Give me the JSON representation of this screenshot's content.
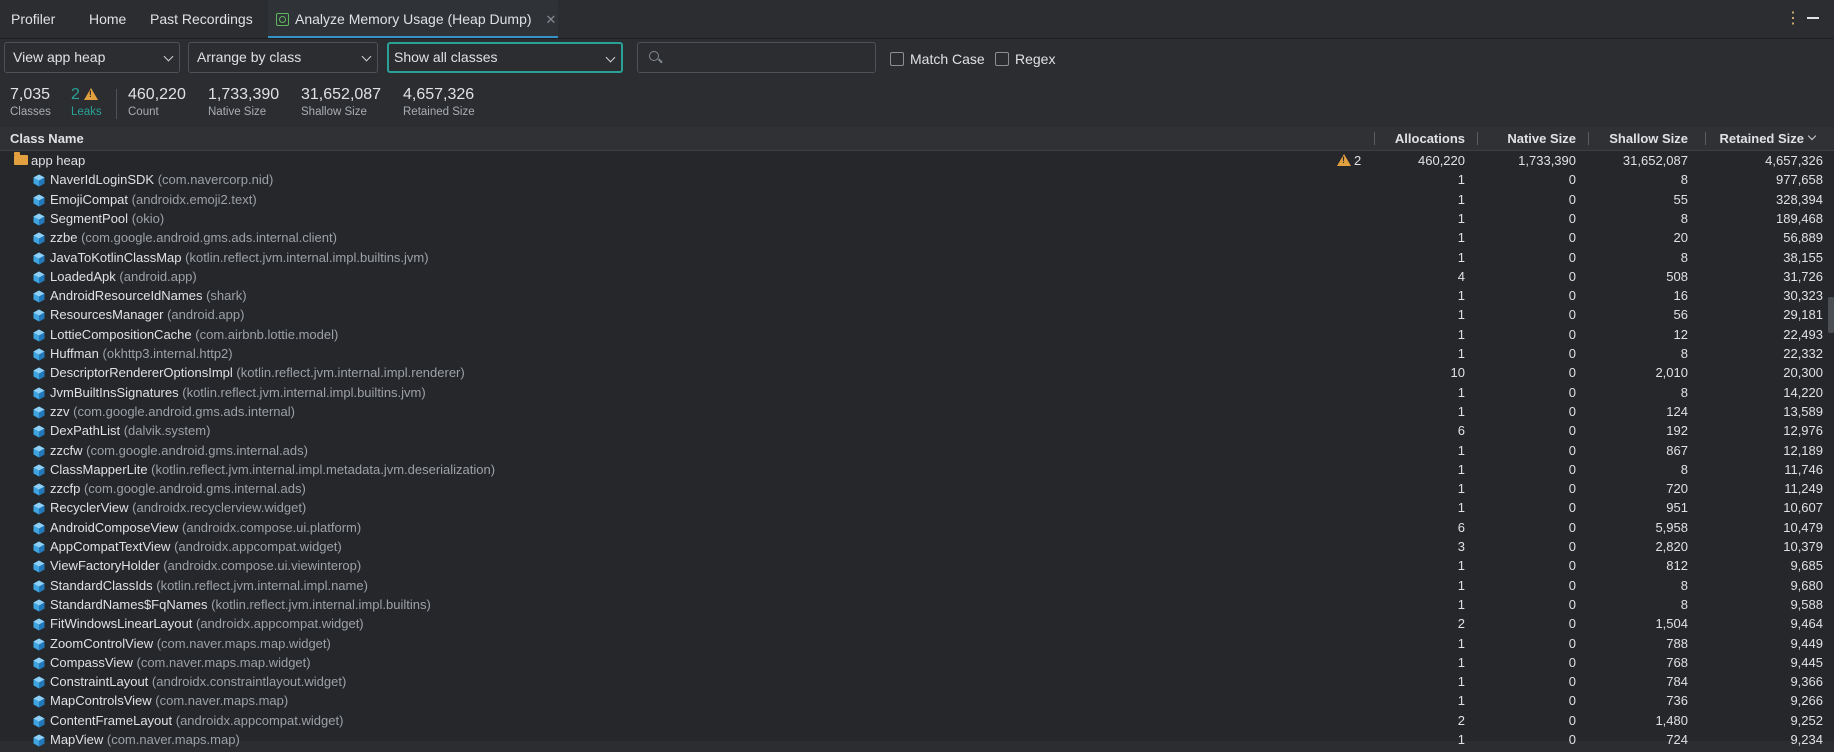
{
  "tabs": [
    {
      "label": "Profiler"
    },
    {
      "label": "Home"
    },
    {
      "label": "Past Recordings"
    },
    {
      "label": "Analyze Memory Usage (Heap Dump)",
      "active": true
    }
  ],
  "filters": {
    "heap": "View app heap",
    "arrange": "Arrange by class",
    "show": "Show all classes",
    "search_value": "",
    "match_case": "Match Case",
    "regex": "Regex"
  },
  "stats": {
    "classes": {
      "value": "7,035",
      "label": "Classes"
    },
    "leaks": {
      "value": "2",
      "label": "Leaks"
    },
    "count": {
      "value": "460,220",
      "label": "Count"
    },
    "native": {
      "value": "1,733,390",
      "label": "Native Size"
    },
    "shallow": {
      "value": "31,652,087",
      "label": "Shallow Size"
    },
    "retained": {
      "value": "4,657,326",
      "label": "Retained Size"
    }
  },
  "columns": {
    "class_name": "Class Name",
    "allocations": "Allocations",
    "native_size": "Native Size",
    "shallow_size": "Shallow Size",
    "retained_size": "Retained Size"
  },
  "heap_row": {
    "name": "app heap",
    "leaks": "2",
    "allocations": "460,220",
    "native": "1,733,390",
    "shallow": "31,652,087",
    "retained": "4,657,326"
  },
  "rows": [
    {
      "name": "NaverIdLoginSDK",
      "pkg": "(com.navercorp.nid)",
      "alloc": "1",
      "native": "0",
      "shallow": "8",
      "retained": "977,658"
    },
    {
      "name": "EmojiCompat",
      "pkg": "(androidx.emoji2.text)",
      "alloc": "1",
      "native": "0",
      "shallow": "55",
      "retained": "328,394"
    },
    {
      "name": "SegmentPool",
      "pkg": "(okio)",
      "alloc": "1",
      "native": "0",
      "shallow": "8",
      "retained": "189,468"
    },
    {
      "name": "zzbe",
      "pkg": "(com.google.android.gms.ads.internal.client)",
      "alloc": "1",
      "native": "0",
      "shallow": "20",
      "retained": "56,889"
    },
    {
      "name": "JavaToKotlinClassMap",
      "pkg": "(kotlin.reflect.jvm.internal.impl.builtins.jvm)",
      "alloc": "1",
      "native": "0",
      "shallow": "8",
      "retained": "38,155"
    },
    {
      "name": "LoadedApk",
      "pkg": "(android.app)",
      "alloc": "4",
      "native": "0",
      "shallow": "508",
      "retained": "31,726"
    },
    {
      "name": "AndroidResourceIdNames",
      "pkg": "(shark)",
      "alloc": "1",
      "native": "0",
      "shallow": "16",
      "retained": "30,323"
    },
    {
      "name": "ResourcesManager",
      "pkg": "(android.app)",
      "alloc": "1",
      "native": "0",
      "shallow": "56",
      "retained": "29,181"
    },
    {
      "name": "LottieCompositionCache",
      "pkg": "(com.airbnb.lottie.model)",
      "alloc": "1",
      "native": "0",
      "shallow": "12",
      "retained": "22,493"
    },
    {
      "name": "Huffman",
      "pkg": "(okhttp3.internal.http2)",
      "alloc": "1",
      "native": "0",
      "shallow": "8",
      "retained": "22,332"
    },
    {
      "name": "DescriptorRendererOptionsImpl",
      "pkg": "(kotlin.reflect.jvm.internal.impl.renderer)",
      "alloc": "10",
      "native": "0",
      "shallow": "2,010",
      "retained": "20,300"
    },
    {
      "name": "JvmBuiltInsSignatures",
      "pkg": "(kotlin.reflect.jvm.internal.impl.builtins.jvm)",
      "alloc": "1",
      "native": "0",
      "shallow": "8",
      "retained": "14,220"
    },
    {
      "name": "zzv",
      "pkg": "(com.google.android.gms.ads.internal)",
      "alloc": "1",
      "native": "0",
      "shallow": "124",
      "retained": "13,589"
    },
    {
      "name": "DexPathList",
      "pkg": "(dalvik.system)",
      "alloc": "6",
      "native": "0",
      "shallow": "192",
      "retained": "12,976"
    },
    {
      "name": "zzcfw",
      "pkg": "(com.google.android.gms.internal.ads)",
      "alloc": "1",
      "native": "0",
      "shallow": "867",
      "retained": "12,189"
    },
    {
      "name": "ClassMapperLite",
      "pkg": "(kotlin.reflect.jvm.internal.impl.metadata.jvm.deserialization)",
      "alloc": "1",
      "native": "0",
      "shallow": "8",
      "retained": "11,746"
    },
    {
      "name": "zzcfp",
      "pkg": "(com.google.android.gms.internal.ads)",
      "alloc": "1",
      "native": "0",
      "shallow": "720",
      "retained": "11,249"
    },
    {
      "name": "RecyclerView",
      "pkg": "(androidx.recyclerview.widget)",
      "alloc": "1",
      "native": "0",
      "shallow": "951",
      "retained": "10,607"
    },
    {
      "name": "AndroidComposeView",
      "pkg": "(androidx.compose.ui.platform)",
      "alloc": "6",
      "native": "0",
      "shallow": "5,958",
      "retained": "10,479"
    },
    {
      "name": "AppCompatTextView",
      "pkg": "(androidx.appcompat.widget)",
      "alloc": "3",
      "native": "0",
      "shallow": "2,820",
      "retained": "10,379"
    },
    {
      "name": "ViewFactoryHolder",
      "pkg": "(androidx.compose.ui.viewinterop)",
      "alloc": "1",
      "native": "0",
      "shallow": "812",
      "retained": "9,685"
    },
    {
      "name": "StandardClassIds",
      "pkg": "(kotlin.reflect.jvm.internal.impl.name)",
      "alloc": "1",
      "native": "0",
      "shallow": "8",
      "retained": "9,680"
    },
    {
      "name": "StandardNames$FqNames",
      "pkg": "(kotlin.reflect.jvm.internal.impl.builtins)",
      "alloc": "1",
      "native": "0",
      "shallow": "8",
      "retained": "9,588"
    },
    {
      "name": "FitWindowsLinearLayout",
      "pkg": "(androidx.appcompat.widget)",
      "alloc": "2",
      "native": "0",
      "shallow": "1,504",
      "retained": "9,464"
    },
    {
      "name": "ZoomControlView",
      "pkg": "(com.naver.maps.map.widget)",
      "alloc": "1",
      "native": "0",
      "shallow": "788",
      "retained": "9,449"
    },
    {
      "name": "CompassView",
      "pkg": "(com.naver.maps.map.widget)",
      "alloc": "1",
      "native": "0",
      "shallow": "768",
      "retained": "9,445"
    },
    {
      "name": "ConstraintLayout",
      "pkg": "(androidx.constraintlayout.widget)",
      "alloc": "1",
      "native": "0",
      "shallow": "784",
      "retained": "9,366"
    },
    {
      "name": "MapControlsView",
      "pkg": "(com.naver.maps.map)",
      "alloc": "1",
      "native": "0",
      "shallow": "736",
      "retained": "9,266"
    },
    {
      "name": "ContentFrameLayout",
      "pkg": "(androidx.appcompat.widget)",
      "alloc": "2",
      "native": "0",
      "shallow": "1,480",
      "retained": "9,252"
    },
    {
      "name": "MapView",
      "pkg": "(com.naver.maps.map)",
      "alloc": "1",
      "native": "0",
      "shallow": "724",
      "retained": "9,234"
    }
  ]
}
